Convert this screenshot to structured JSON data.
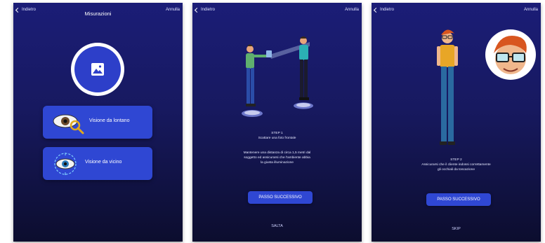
{
  "screens": [
    {
      "back_label": "Indietro",
      "title": "Misurazioni",
      "cancel_label": "Annulla",
      "options": [
        {
          "label": "Visione da lontano",
          "icon": "eye-magnifier-icon"
        },
        {
          "label": "Visione da vicino",
          "icon": "eye-target-icon"
        }
      ],
      "photo_icon": "image-icon"
    },
    {
      "back_label": "Indietro",
      "cancel_label": "Annulla",
      "step_title": "STEP 1",
      "step_subtitle": "Scattare una foto frontale",
      "instructions": [
        "Mantenere una distanza di circa 1,5 metri dal",
        "soggetto ed assicurarsi che l'ambiente abbia",
        "la giusta illuminazione"
      ],
      "next_button": "PASSO SUCCESSIVO",
      "skip_label": "SALTA"
    },
    {
      "back_label": "Indietro",
      "cancel_label": "Annulla",
      "step_title": "STEP 2",
      "instructions": [
        "Assicurarsi che il cliente indossi correttamente",
        "gli occhiali da toscazione"
      ],
      "next_button": "PASSO SUCCESSIVO",
      "skip_label": "SKIP"
    }
  ],
  "colors": {
    "background_top": "#1b1d77",
    "background_bottom": "#0c0d2e",
    "accent": "#2f47d3"
  }
}
